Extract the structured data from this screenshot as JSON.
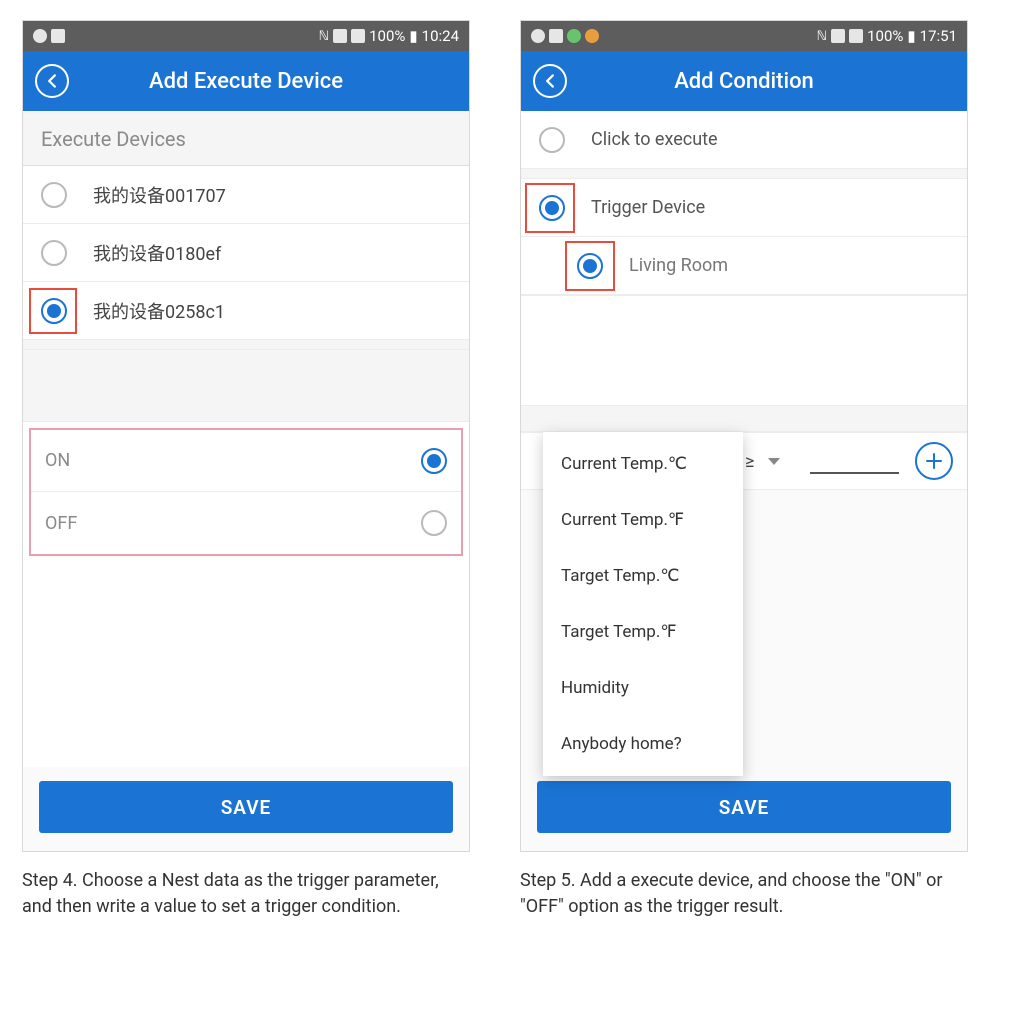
{
  "left": {
    "statusbar": {
      "battery": "100%",
      "time": "10:24"
    },
    "title": "Add Execute Device",
    "section_label": "Execute Devices",
    "devices": [
      {
        "label": "我的设备001707",
        "checked": false
      },
      {
        "label": "我的设备0180ef",
        "checked": false
      },
      {
        "label": "我的设备0258c1",
        "checked": true
      }
    ],
    "onoff": {
      "on_label": "ON",
      "off_label": "OFF"
    },
    "save_label": "SAVE",
    "caption": "Step 4. Choose a Nest data as the trigger parameter, and then write a value to set a trigger condition."
  },
  "right": {
    "statusbar": {
      "battery": "100%",
      "time": "17:51"
    },
    "title": "Add Condition",
    "click_label": "Click to execute",
    "trigger_label": "Trigger Device",
    "sub_device": "Living Room",
    "compare_symbol": "≥",
    "dropdown": [
      "Current Temp.℃",
      "Current Temp.℉",
      "Target Temp.℃",
      "Target Temp.℉",
      "Humidity",
      "Anybody home?"
    ],
    "save_label": "SAVE",
    "caption": "Step 5. Add a execute device, and choose the \"ON\" or \"OFF\" option as the trigger result."
  }
}
